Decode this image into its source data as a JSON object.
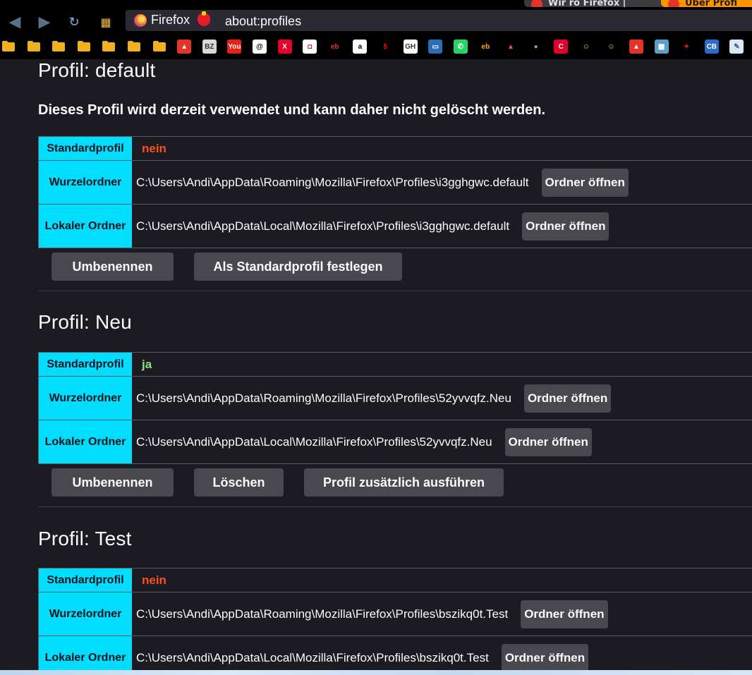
{
  "tabs": [
    {
      "label": "Wir ro Firefox |"
    },
    {
      "label": "Über Profi"
    }
  ],
  "navbar": {
    "identity_label": "Firefox",
    "url": "about:profiles",
    "back_icon": "back-arrow-icon",
    "forward_icon": "forward-arrow-icon",
    "reload_icon": "reload-icon",
    "home_icon": "page-icon"
  },
  "bookmarks": [
    {
      "label": "",
      "type": "folder"
    },
    {
      "label": "",
      "type": "folder"
    },
    {
      "label": "",
      "type": "folder"
    },
    {
      "label": "",
      "type": "folder"
    },
    {
      "label": "",
      "type": "folder"
    },
    {
      "label": "",
      "type": "folder"
    },
    {
      "label": "",
      "type": "folder"
    },
    {
      "label": "▲",
      "bg": "#e6332a"
    },
    {
      "label": "BZ",
      "bg": "#d8d8d8",
      "fg": "#333333"
    },
    {
      "label": "You",
      "bg": "#e62117"
    },
    {
      "label": "@",
      "bg": "#ffffff",
      "fg": "#000000"
    },
    {
      "label": "X",
      "bg": "#e4002b"
    },
    {
      "label": "◘",
      "bg": "#ffffff",
      "fg": "#c00000"
    },
    {
      "label": "eb",
      "bg": "#000000",
      "fg": "#e53238"
    },
    {
      "label": "a",
      "bg": "#ffffff",
      "fg": "#000000"
    },
    {
      "label": "$",
      "bg": "#000000",
      "fg": "#ff0000"
    },
    {
      "label": "GH",
      "bg": "#ffffff",
      "fg": "#333333"
    },
    {
      "label": "▭",
      "bg": "#2a6eb5"
    },
    {
      "label": "✆",
      "bg": "#25d366"
    },
    {
      "label": "eb",
      "bg": "#000000",
      "fg": "#f5af02"
    },
    {
      "label": "▲",
      "bg": "#000000",
      "fg": "#ff3c8e"
    },
    {
      "label": "●",
      "bg": "#000000",
      "fg": "#9a9a9a"
    },
    {
      "label": "C",
      "bg": "#e4002b"
    },
    {
      "label": "☺",
      "bg": "#000000",
      "fg": "#f8d23a"
    },
    {
      "label": "☺",
      "bg": "#000000",
      "fg": "#f8e03a"
    },
    {
      "label": "▲",
      "bg": "#e6332a"
    },
    {
      "label": "▦",
      "bg": "#5aa0c8"
    },
    {
      "label": "✦",
      "bg": "#000000",
      "fg": "#e21b22"
    },
    {
      "label": "CB",
      "bg": "#2b6cc4"
    },
    {
      "label": "✎",
      "bg": "#dfe8f2",
      "fg": "#2a5fa5"
    }
  ],
  "labels": {
    "default_profile": "Standardprofil",
    "root_dir": "Wurzelordner",
    "local_dir": "Lokaler Ordner",
    "open_folder": "Ordner öffnen",
    "rename": "Umbenennen",
    "set_default": "Als Standardprofil festlegen",
    "delete": "Löschen",
    "launch": "Profil zusätzlich ausführen"
  },
  "profiles": [
    {
      "title": "Profil: default",
      "note": "Dieses Profil wird derzeit verwendet und kann daher nicht gelöscht werden.",
      "is_default": "nein",
      "root_dir": "C:\\Users\\Andi\\AppData\\Roaming\\Mozilla\\Firefox\\Profiles\\i3gghgwc.default",
      "local_dir": "C:\\Users\\Andi\\AppData\\Local\\Mozilla\\Firefox\\Profiles\\i3gghgwc.default"
    },
    {
      "title": "Profil: Neu",
      "is_default": "ja",
      "root_dir": "C:\\Users\\Andi\\AppData\\Roaming\\Mozilla\\Firefox\\Profiles\\52yvvqfz.Neu",
      "local_dir": "C:\\Users\\Andi\\AppData\\Local\\Mozilla\\Firefox\\Profiles\\52yvvqfz.Neu"
    },
    {
      "title": "Profil: Test",
      "is_default": "nein",
      "root_dir": "C:\\Users\\Andi\\AppData\\Roaming\\Mozilla\\Firefox\\Profiles\\bszikq0t.Test",
      "local_dir": "C:\\Users\\Andi\\AppData\\Local\\Mozilla\\Firefox\\Profiles\\bszikq0t.Test"
    }
  ],
  "colors": {
    "label_bg": "#00ddff",
    "no_value": "#ff4f1f",
    "yes_value": "#84e77f"
  }
}
